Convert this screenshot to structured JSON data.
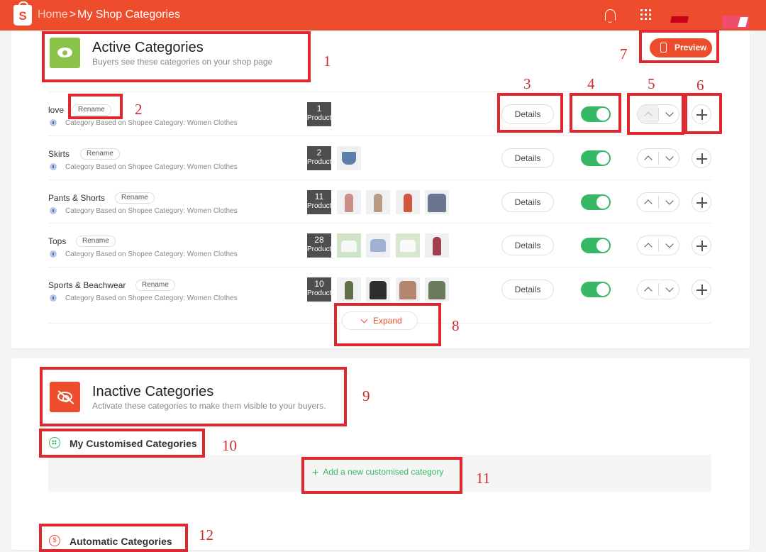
{
  "header": {
    "breadcrumb_home": "Home",
    "breadcrumb_separator": ">",
    "breadcrumb_current": "My Shop Categories",
    "logo_letter": "S",
    "icons": [
      "shopee-bag-logo",
      "bell-icon",
      "apps-grid-icon"
    ],
    "accent_color": "#ee4d2d"
  },
  "active": {
    "title": "Active Categories",
    "subtitle": "Buyers see these categories on your shop page",
    "preview_label": "Preview",
    "expand_label": "Expand",
    "categories": [
      {
        "name": "love",
        "rename_label": "Rename",
        "based_on": "Category Based on Shopee Category: Women Clothes",
        "count": "1",
        "count_label": "Products",
        "details_label": "Details",
        "enabled": true,
        "extra_images": 0
      },
      {
        "name": "Skirts",
        "rename_label": "Rename",
        "based_on": "Category Based on Shopee Category: Women Clothes",
        "count": "2",
        "count_label": "Products",
        "details_label": "Details",
        "enabled": true,
        "extra_images": 1
      },
      {
        "name": "Pants & Shorts",
        "rename_label": "Rename",
        "based_on": "Category Based on Shopee Category: Women Clothes",
        "count": "11",
        "count_label": "Products",
        "details_label": "Details",
        "enabled": true,
        "extra_images": 4
      },
      {
        "name": "Tops",
        "rename_label": "Rename",
        "based_on": "Category Based on Shopee Category: Women Clothes",
        "count": "28",
        "count_label": "Products",
        "details_label": "Details",
        "enabled": true,
        "extra_images": 4
      },
      {
        "name": "Sports & Beachwear",
        "rename_label": "Rename",
        "based_on": "Category Based on Shopee Category: Women Clothes",
        "count": "10",
        "count_label": "Products",
        "details_label": "Details",
        "enabled": true,
        "extra_images": 4
      }
    ]
  },
  "inactive": {
    "title": "Inactive Categories",
    "subtitle": "Activate these categories to make them visible to your buyers.",
    "customised_title": "My Customised Categories",
    "add_label": "Add a new customised category",
    "automatic_title": "Automatic Categories"
  },
  "annotations": [
    "1",
    "2",
    "3",
    "4",
    "5",
    "6",
    "7",
    "8",
    "9",
    "10",
    "11",
    "12"
  ],
  "colors": {
    "toggle_on": "#36b864",
    "annotation": "#e0262e",
    "active_icon": "#8bc34a"
  }
}
